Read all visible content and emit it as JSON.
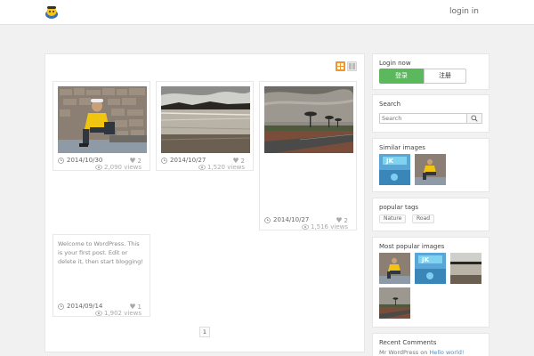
{
  "header": {
    "login_label": "login in"
  },
  "main": {
    "posts": [
      {
        "date": "2014/10/30",
        "likes": "2",
        "views": "2,090 views"
      },
      {
        "date": "2014/10/27",
        "likes": "2",
        "views": "1,520 views"
      },
      {
        "date": "2014/10/27",
        "likes": "2",
        "views": "1,516 views"
      },
      {
        "excerpt": "Welcome to WordPress. This is your first post. Edit or delete it, then start blogging!",
        "date": "2014/09/14",
        "likes": "1",
        "views": "1,902 views"
      }
    ],
    "page_number": "1"
  },
  "sidebar": {
    "login": {
      "title": "Login now",
      "primary_label": "登录",
      "secondary_label": "注册"
    },
    "search": {
      "title": "Search",
      "placeholder": "Search"
    },
    "similar": {
      "title": "Similar images"
    },
    "tags": {
      "title": "popular tags",
      "items": [
        "Nature",
        "Road"
      ]
    },
    "popular": {
      "title": "Most popular images"
    },
    "comments": {
      "title": "Recent Comments",
      "author": "Mr WordPress",
      "connector": "on",
      "post": "Hello world!"
    }
  },
  "colors": {
    "accent": "#f0962b",
    "green": "#5cb85c",
    "link": "#4a8fc7"
  }
}
